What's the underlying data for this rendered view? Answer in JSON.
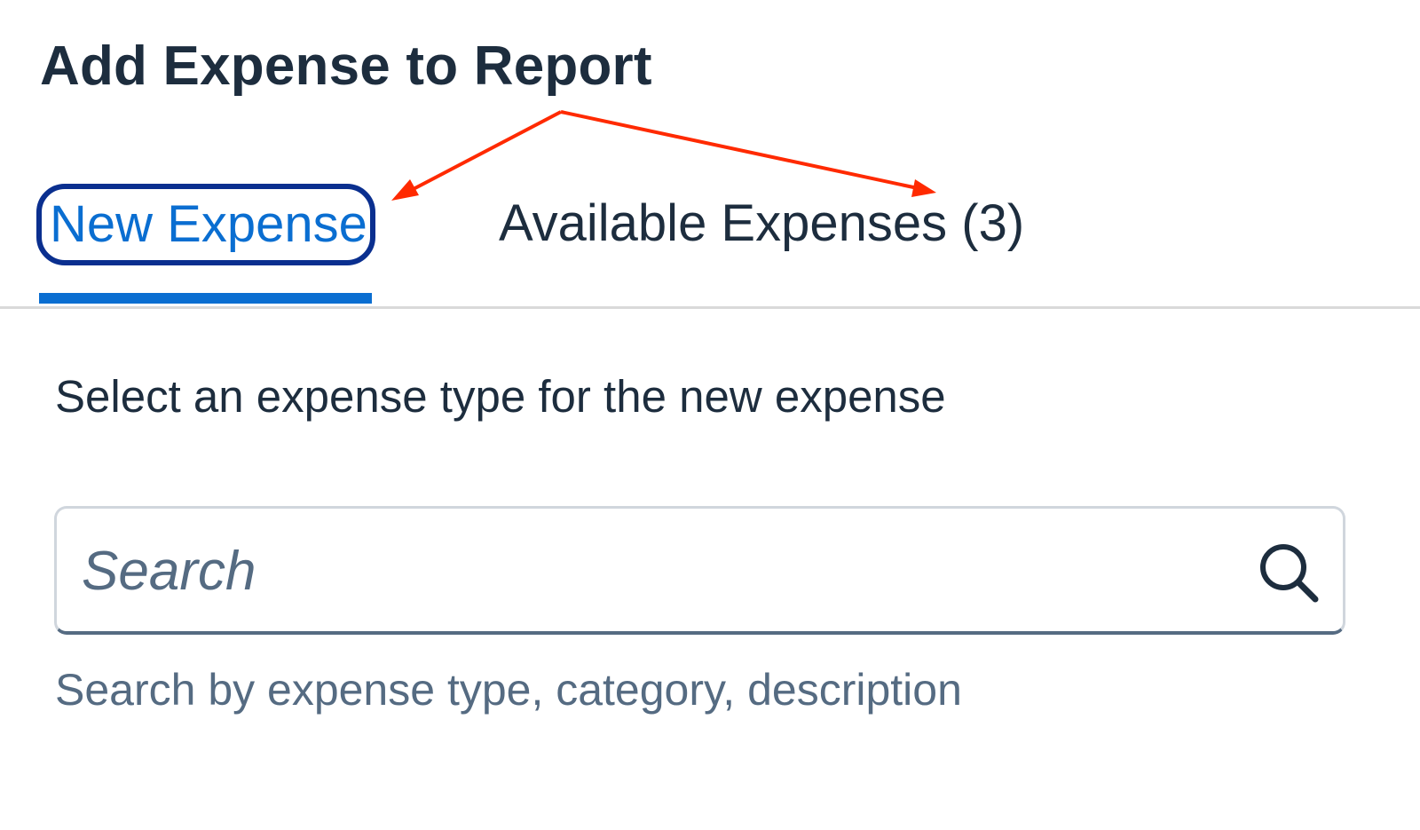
{
  "header": {
    "title": "Add Expense to Report"
  },
  "tabs": [
    {
      "label": "New Expense",
      "selected": true
    },
    {
      "label": "Available Expenses (3)",
      "selected": false
    }
  ],
  "annotation": {
    "arrow_color": "#ff2a00"
  },
  "main": {
    "instruction": "Select an expense type for the new expense",
    "search": {
      "placeholder": "Search",
      "value": "",
      "icon": "search-icon"
    },
    "hint": "Search by expense type, category, description"
  },
  "colors": {
    "accent": "#0a6ed1",
    "focus_outline": "#0a2f8f",
    "text": "#1d2d3e",
    "muted_text": "#556b82"
  }
}
